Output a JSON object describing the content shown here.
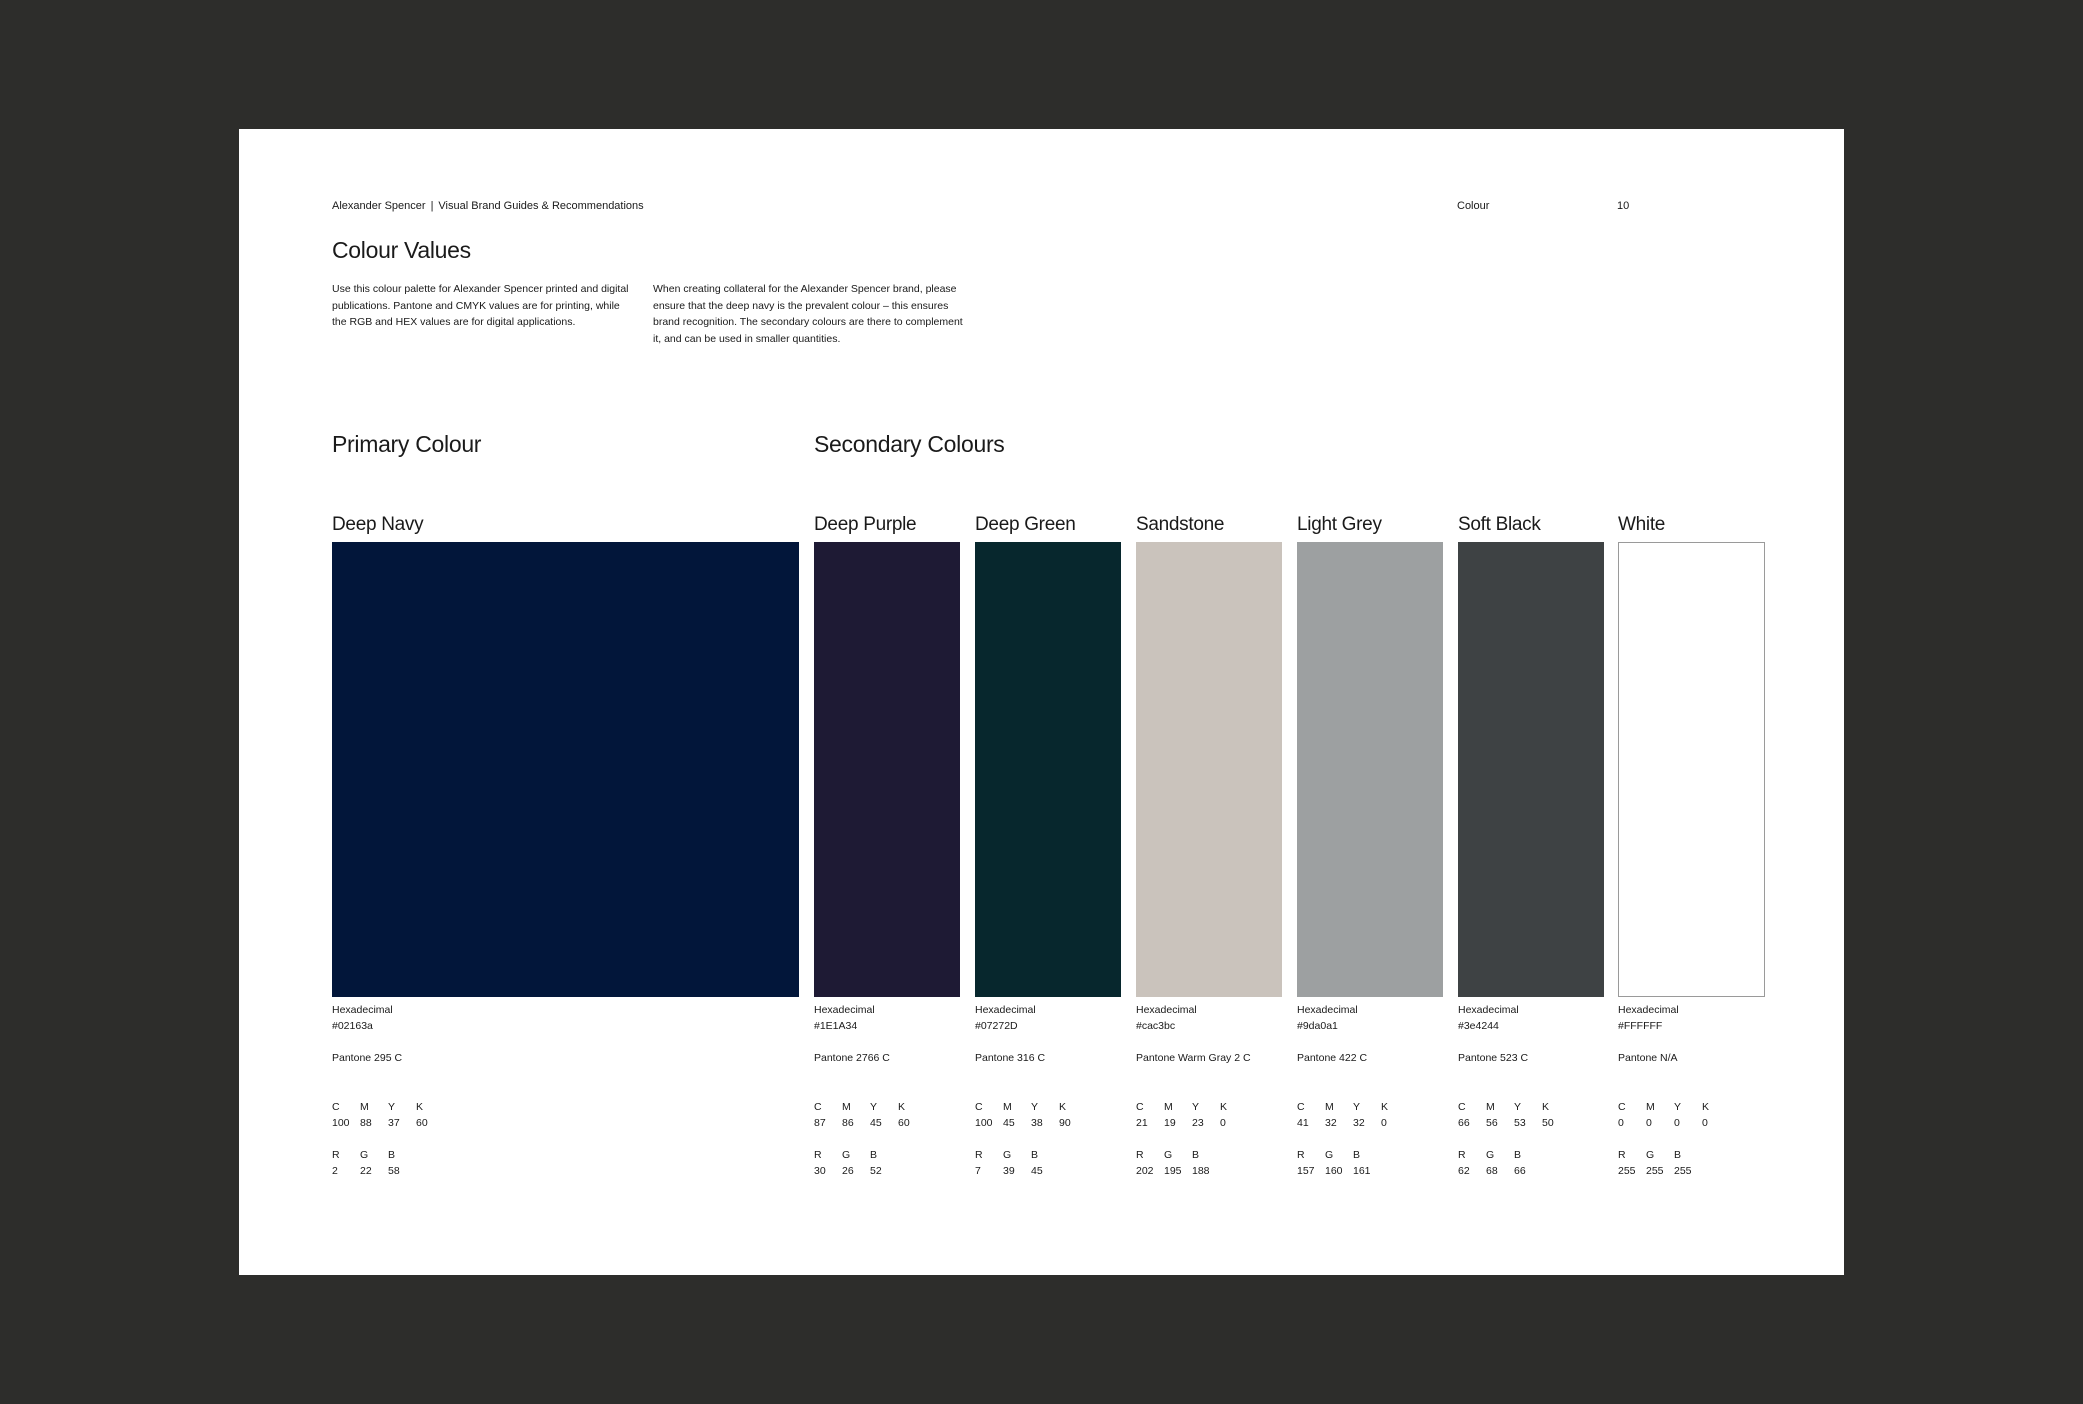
{
  "header": {
    "brand": "Alexander Spencer",
    "separator": "|",
    "doc_title": "Visual Brand Guides & Recommendations",
    "section": "Colour",
    "page_number": "10"
  },
  "title": "Colour Values",
  "intro": [
    "Use this colour palette for Alexander Spencer printed and digital publications. Pantone and CMYK values are for printing, while the RGB and HEX values are for digital applications.",
    "When creating collateral for the Alexander Spencer brand, please ensure that the deep navy is the prevalent colour – this ensures brand recognition. The secondary colours are there to complement it, and can be used in smaller quantities."
  ],
  "primary_heading": "Primary Colour",
  "secondary_heading": "Secondary Colours",
  "labels": {
    "hex": "Hexadecimal",
    "c": "C",
    "m": "M",
    "y": "Y",
    "k": "K",
    "r": "R",
    "g": "G",
    "b": "B"
  },
  "colors": [
    {
      "name": "Deep Navy",
      "hex": "#02163a",
      "swatch": "#02163a",
      "pantone": "Pantone 295 C",
      "cmyk": [
        "100",
        "88",
        "37",
        "60"
      ],
      "rgb": [
        "2",
        "22",
        "58"
      ]
    },
    {
      "name": "Deep Purple",
      "hex": "#1E1A34",
      "swatch": "#1E1A34",
      "pantone": "Pantone 2766 C",
      "cmyk": [
        "87",
        "86",
        "45",
        "60"
      ],
      "rgb": [
        "30",
        "26",
        "52"
      ]
    },
    {
      "name": "Deep Green",
      "hex": "#07272D",
      "swatch": "#07272D",
      "pantone": "Pantone 316 C",
      "cmyk": [
        "100",
        "45",
        "38",
        "90"
      ],
      "rgb": [
        "7",
        "39",
        "45"
      ]
    },
    {
      "name": "Sandstone",
      "hex": "#cac3bc",
      "swatch": "#cac3bc",
      "pantone": "Pantone Warm Gray 2 C",
      "cmyk": [
        "21",
        "19",
        "23",
        "0"
      ],
      "rgb": [
        "202",
        "195",
        "188"
      ]
    },
    {
      "name": "Light Grey",
      "hex": "#9da0a1",
      "swatch": "#9da0a1",
      "pantone": "Pantone 422 C",
      "cmyk": [
        "41",
        "32",
        "32",
        "0"
      ],
      "rgb": [
        "157",
        "160",
        "161"
      ]
    },
    {
      "name": "Soft Black",
      "hex": "#3e4244",
      "swatch": "#3e4244",
      "pantone": "Pantone 523 C",
      "cmyk": [
        "66",
        "56",
        "53",
        "50"
      ],
      "rgb": [
        "62",
        "68",
        "66"
      ]
    },
    {
      "name": "White",
      "hex": "#FFFFFF",
      "swatch": "#FFFFFF",
      "pantone": "Pantone N/A",
      "cmyk": [
        "0",
        "0",
        "0",
        "0"
      ],
      "rgb": [
        "255",
        "255",
        "255"
      ]
    }
  ]
}
